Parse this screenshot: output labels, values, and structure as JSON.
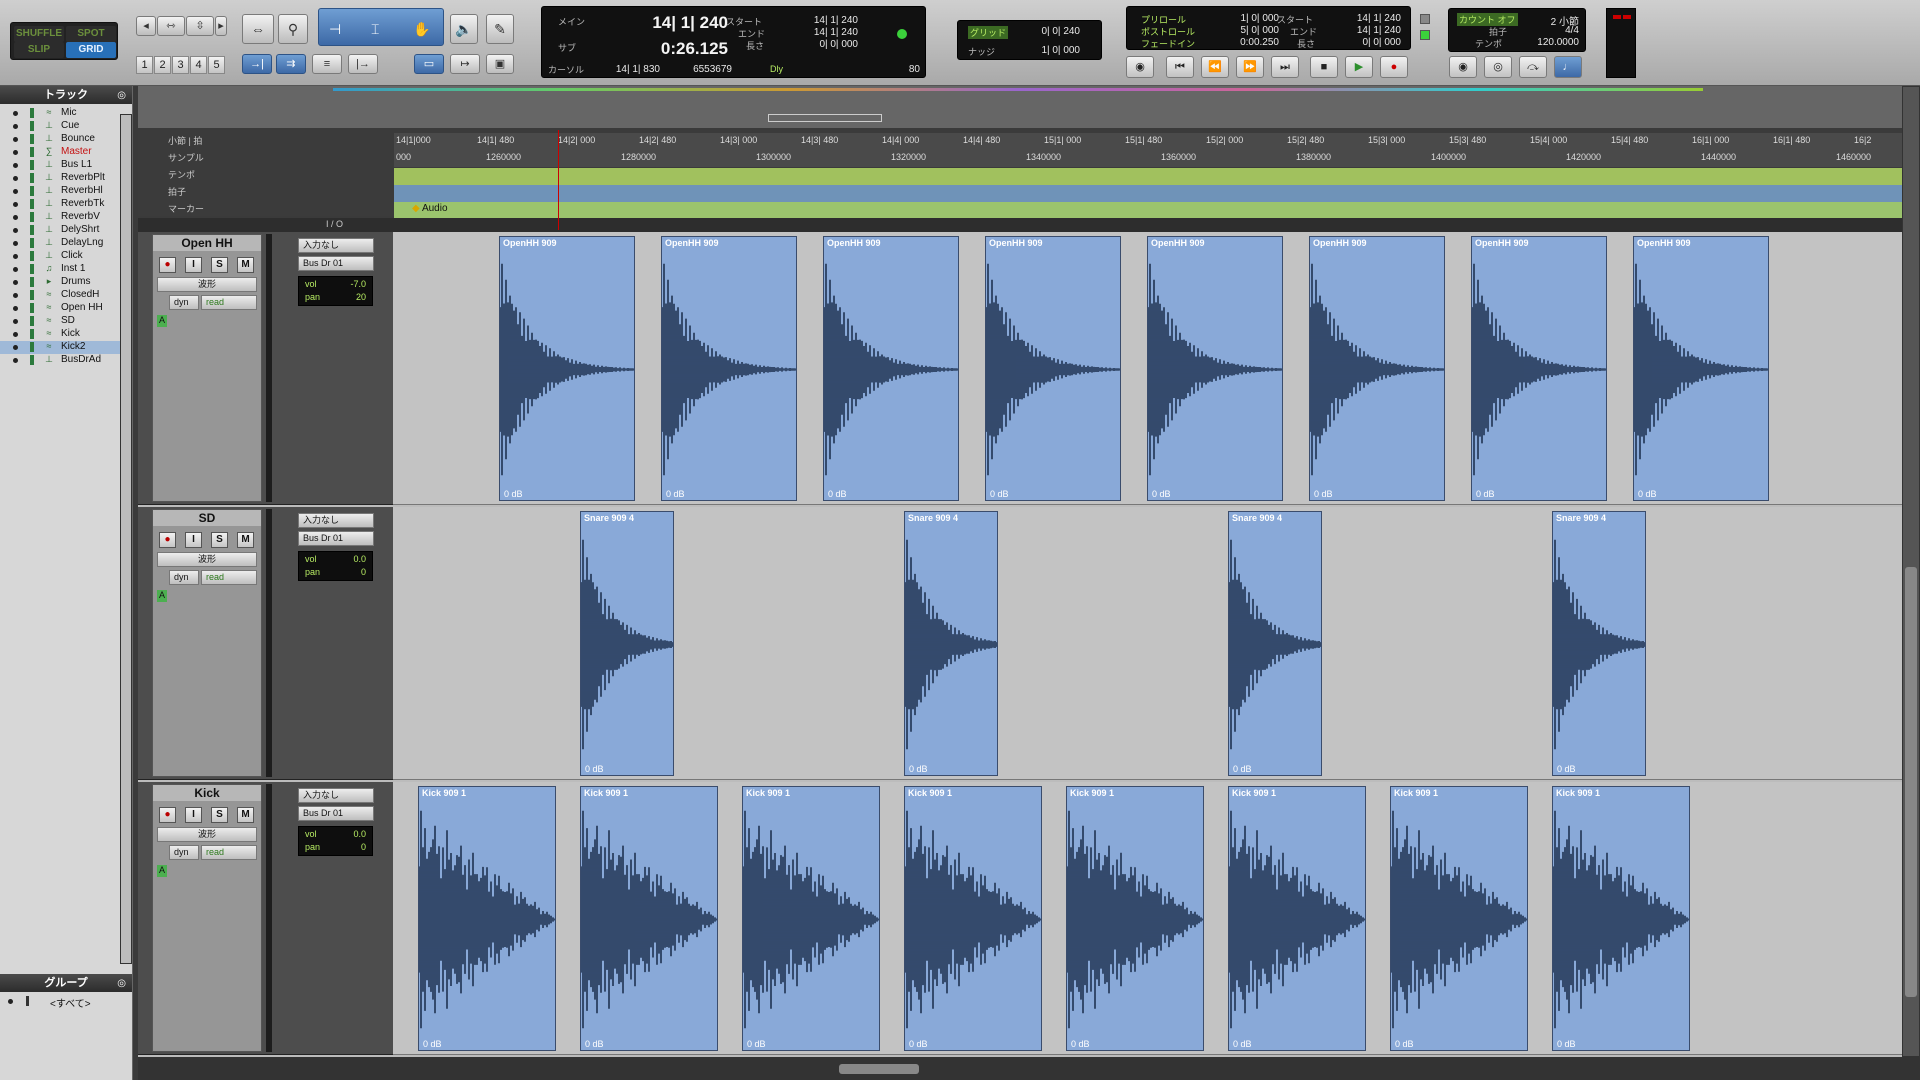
{
  "edit_modes": {
    "shuffle": "SHUFFLE",
    "spot": "SPOT",
    "slip": "SLIP",
    "grid": "GRID"
  },
  "zoom_presets": [
    "1",
    "2",
    "3",
    "4",
    "5"
  ],
  "counters": {
    "main_label": "メイン",
    "main_value": "14| 1| 240",
    "sub_label": "サブ",
    "sub_value": "0:26.125",
    "cursor_label": "カーソル",
    "cursor_value": "14| 1| 830",
    "sample_value": "6553679",
    "start_label": "スタート",
    "end_label": "エンド",
    "length_label": "長さ",
    "start_value": "14| 1| 240",
    "end_value": "14| 1| 240",
    "length_value": "0| 0| 000",
    "dly_label": "Dly",
    "nudge_label": "ナッジ",
    "grid_label": "グリッド",
    "grid_value": "0| 0| 240",
    "nudge_value": "1| 0| 000",
    "preroll_label": "プリロール",
    "postroll_label": "ポストロール",
    "fadein_label": "フェードイン",
    "preroll_value": "1| 0| 000",
    "postroll_value": "5| 0| 000",
    "fadein_value": "0:00.250",
    "start2_value": "14| 1| 240",
    "end2_value": "14| 1| 240",
    "length2_value": "0| 0| 000",
    "countoff_label": "カウント オフ",
    "countoff_value": "2 小節",
    "meter_label": "拍子",
    "meter_value": "4/4",
    "tempo_label": "テンポ",
    "tempo_value": "120.0000",
    "volume_value": "80"
  },
  "sidebar": {
    "title": "トラック",
    "tracks": [
      {
        "name": "Mic",
        "type": "audio"
      },
      {
        "name": "Cue",
        "type": "aux"
      },
      {
        "name": "Bounce",
        "type": "aux"
      },
      {
        "name": "Master",
        "type": "master"
      },
      {
        "name": "Bus L1",
        "type": "aux"
      },
      {
        "name": "ReverbPlt",
        "type": "aux"
      },
      {
        "name": "ReverbHl",
        "type": "aux"
      },
      {
        "name": "ReverbTk",
        "type": "aux"
      },
      {
        "name": "ReverbV",
        "type": "aux"
      },
      {
        "name": "DelyShrt",
        "type": "aux"
      },
      {
        "name": "DelayLng",
        "type": "aux"
      },
      {
        "name": "Click",
        "type": "aux"
      },
      {
        "name": "Inst 1",
        "type": "instrument"
      },
      {
        "name": "Drums",
        "type": "folder"
      },
      {
        "name": "ClosedH",
        "type": "audio"
      },
      {
        "name": "Open HH",
        "type": "audio"
      },
      {
        "name": "SD",
        "type": "audio"
      },
      {
        "name": "Kick",
        "type": "audio"
      },
      {
        "name": "Kick2",
        "type": "audio",
        "selected": true
      },
      {
        "name": "BusDrAd",
        "type": "aux"
      }
    ],
    "groups_title": "グループ",
    "group_all": "<すべて>"
  },
  "rulers": {
    "bars_label": "小節 | 拍",
    "samples_label": "サンプル",
    "tempo_label": "テンポ",
    "meter_label": "拍子",
    "markers_label": "マーカー",
    "bar_ticks": [
      "14|1|000",
      "14|1| 480",
      "14|2| 000",
      "14|2| 480",
      "14|3| 000",
      "14|3| 480",
      "14|4| 000",
      "14|4| 480",
      "15|1| 000",
      "15|1| 480",
      "15|2| 000",
      "15|2| 480",
      "15|3| 000",
      "15|3| 480",
      "15|4| 000",
      "15|4| 480",
      "16|1| 000",
      "16|1| 480",
      "16|2"
    ],
    "sample_ticks": [
      "000",
      "1260000",
      "1280000",
      "1300000",
      "1320000",
      "1340000",
      "1360000",
      "1380000",
      "1400000",
      "1420000",
      "1440000",
      "1460000"
    ],
    "marker_name": "Audio",
    "io_label": "I / O"
  },
  "tracks": [
    {
      "name": "Open HH",
      "input": "入力なし",
      "output": "Bus Dr 01",
      "view": "波形",
      "auto_dyn": "dyn",
      "auto_mode": "read",
      "vol": "-7.0",
      "pan": "20",
      "clip_name": "OpenHH 909",
      "clip_gain": "0 dB",
      "clips": 8
    },
    {
      "name": "SD",
      "input": "入力なし",
      "output": "Bus Dr 01",
      "view": "波形",
      "auto_dyn": "dyn",
      "auto_mode": "read",
      "vol": "0.0",
      "pan": "0",
      "clip_name": "Snare 909 4",
      "clip_gain": "0 dB",
      "clips": 4
    },
    {
      "name": "Kick",
      "input": "入力なし",
      "output": "Bus Dr 01",
      "view": "波形",
      "auto_dyn": "dyn",
      "auto_mode": "read",
      "vol": "0.0",
      "pan": "0",
      "clip_name": "Kick 909 1",
      "clip_gain": "0 dB",
      "clips": 8
    }
  ],
  "buttons": {
    "rec": "●",
    "input": "I",
    "solo": "S",
    "mute": "M",
    "vol_label": "vol",
    "pan_label": "pan"
  }
}
